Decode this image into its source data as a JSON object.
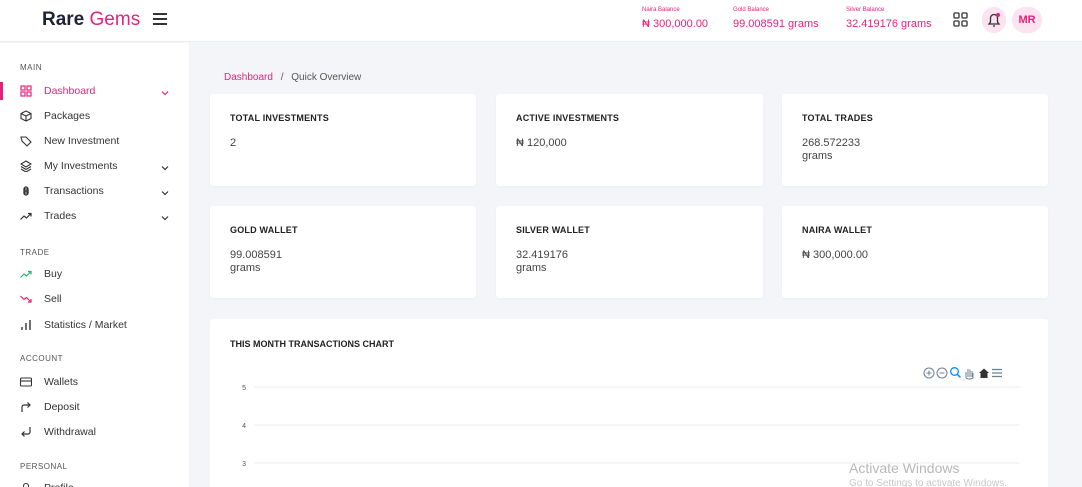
{
  "brand": {
    "bold": "Rare",
    "rest": " Gems"
  },
  "balances": [
    {
      "label": "Naira Balance",
      "value": "₦ 300,000.00"
    },
    {
      "label": "Gold Balance",
      "value": "99.008591 grams"
    },
    {
      "label": "Silver Balance",
      "value": "32.419176 grams"
    }
  ],
  "user": {
    "initials": "MR"
  },
  "sidebar": {
    "sections": {
      "main": "MAIN",
      "trade": "TRADE",
      "account": "ACCOUNT",
      "personal": "PERSONAL"
    },
    "items": [
      {
        "label": "Dashboard",
        "icon": "grid-icon"
      },
      {
        "label": "Packages",
        "icon": "package-icon"
      },
      {
        "label": "New Investment",
        "icon": "tag-icon"
      },
      {
        "label": "My Investments",
        "icon": "layers-icon"
      },
      {
        "label": "Transactions",
        "icon": "command-icon"
      },
      {
        "label": "Trades",
        "icon": "trend-icon"
      },
      {
        "label": "Buy",
        "icon": "trending-up-icon"
      },
      {
        "label": "Sell",
        "icon": "trending-down-icon"
      },
      {
        "label": "Statistics / Market",
        "icon": "bar-chart-icon"
      },
      {
        "label": "Wallets",
        "icon": "wallet-icon"
      },
      {
        "label": "Deposit",
        "icon": "deposit-icon"
      },
      {
        "label": "Withdrawal",
        "icon": "withdraw-icon"
      },
      {
        "label": "Profile",
        "icon": "user-icon"
      }
    ]
  },
  "breadcrumb": {
    "home": "Dashboard",
    "separator": "/",
    "current": "Quick Overview"
  },
  "cards": [
    {
      "title": "TOTAL INVESTMENTS",
      "value": "2",
      "unit": ""
    },
    {
      "title": "ACTIVE INVESTMENTS",
      "value": "₦ 120,000",
      "unit": ""
    },
    {
      "title": "TOTAL TRADES",
      "value": "268.572233",
      "unit": "grams"
    },
    {
      "title": "GOLD WALLET",
      "value": "99.008591",
      "unit": "grams"
    },
    {
      "title": "SILVER WALLET",
      "value": "32.419176",
      "unit": "grams"
    },
    {
      "title": "NAIRA WALLET",
      "value": "₦ 300,000.00",
      "unit": ""
    }
  ],
  "chart": {
    "title": "THIS MONTH TRANSACTIONS CHART",
    "y_ticks": [
      "5",
      "4",
      "3"
    ]
  },
  "chart_data": {
    "type": "line",
    "title": "THIS MONTH TRANSACTIONS CHART",
    "series": [],
    "yticks": [
      5,
      4,
      3
    ],
    "grid": true
  },
  "watermark": {
    "line1": "Activate Windows",
    "line2": "Go to Settings to activate Windows."
  },
  "colors": {
    "accent": "#e5227b",
    "green": "#22b573"
  }
}
